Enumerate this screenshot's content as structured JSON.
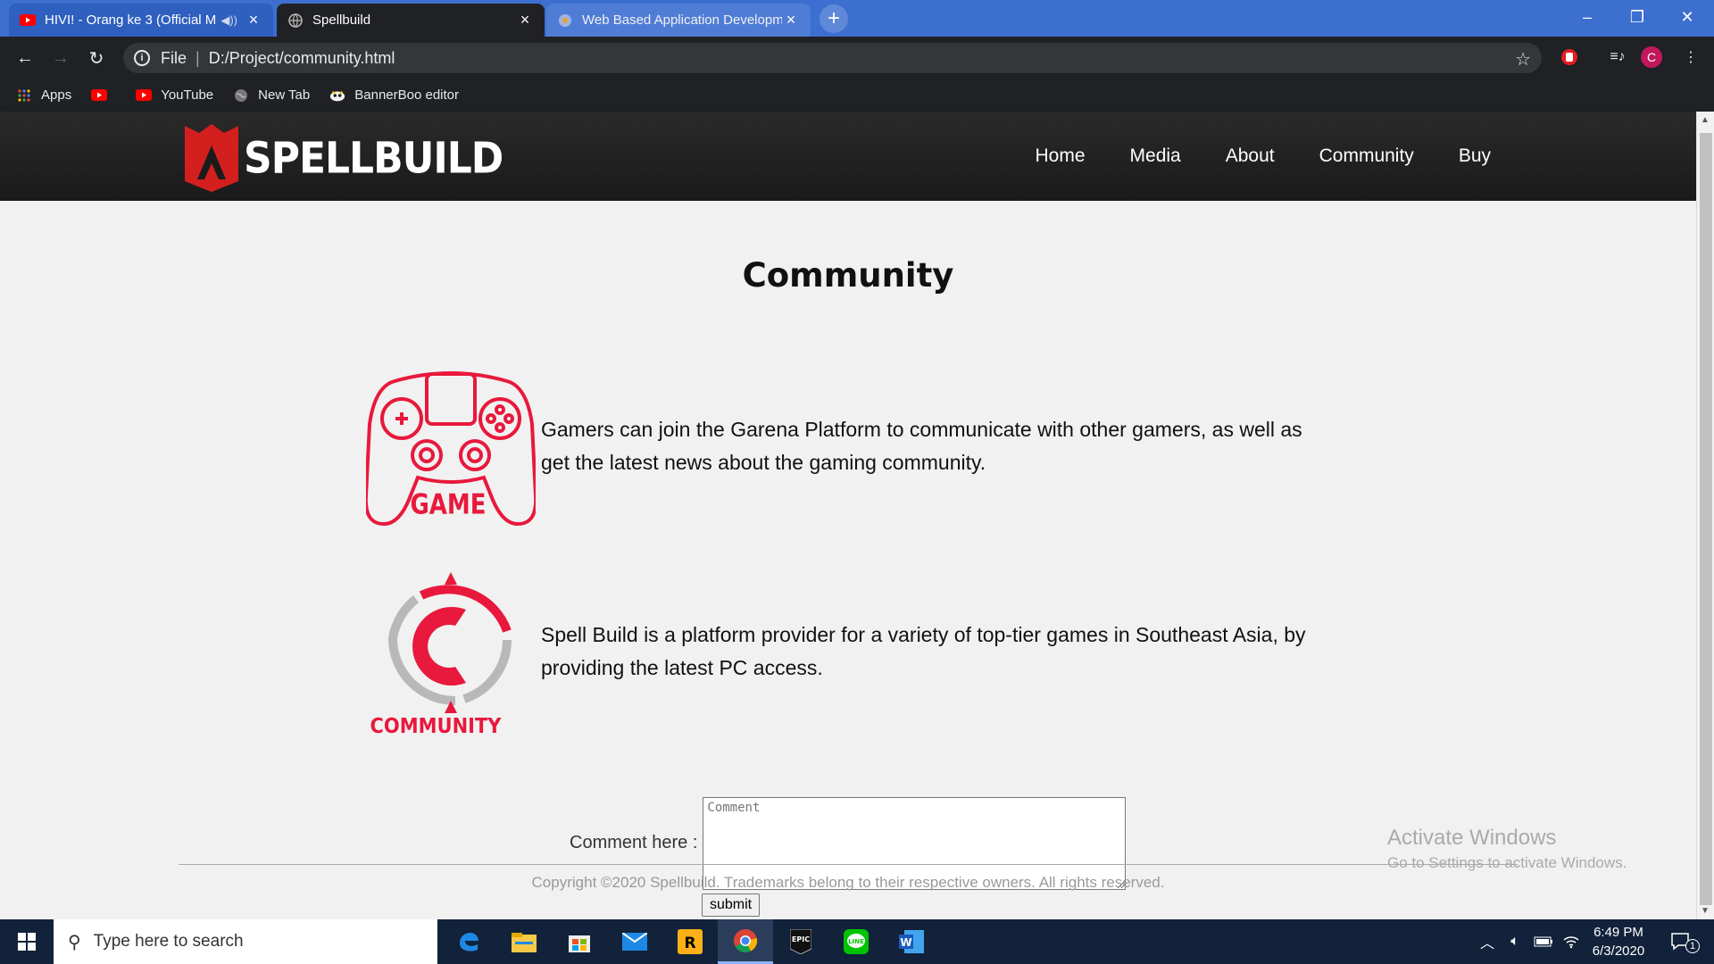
{
  "browser": {
    "tabs": [
      {
        "title": "HIVI! - Orang ke 3 (Official M",
        "icon": "youtube-icon"
      },
      {
        "title": "Spellbuild",
        "icon": "globe-icon"
      },
      {
        "title": "Web Based Application Developm",
        "icon": "page-icon"
      }
    ],
    "url_scheme": "File",
    "url": "D:/Project/community.html",
    "profile_initial": "C",
    "bookmarks": [
      {
        "label": "Apps",
        "icon": "apps-grid-icon"
      },
      {
        "label": "",
        "icon": "youtube-icon"
      },
      {
        "label": "YouTube",
        "icon": "youtube-icon"
      },
      {
        "label": "New Tab",
        "icon": "globe-icon"
      },
      {
        "label": "BannerBoo editor",
        "icon": "bannerboo-icon"
      }
    ]
  },
  "site": {
    "brand": "SPELLBUILD",
    "nav": [
      "Home",
      "Media",
      "About",
      "Community",
      "Buy"
    ],
    "page_title": "Community",
    "features": [
      {
        "icon_label": "GAME",
        "icon": "gamepad-icon",
        "text": "Gamers can join the Garena Platform to communicate with other gamers, as well as get the latest news about the gaming community."
      },
      {
        "icon_label": "COMMUNITY",
        "icon": "community-icon",
        "text": "Spell Build is a platform provider for a variety of top-tier games in Southeast Asia, by providing the latest PC access."
      }
    ],
    "comment_label": "Comment here :",
    "comment_placeholder": "Comment",
    "submit_label": "submit",
    "copyright": "Copyright ©2020 Spellbuild. Trademarks belong to their respective owners. All rights reserved.",
    "accent_color": "#e8193c"
  },
  "watermark": {
    "line1": "Activate Windows",
    "line2": "Go to Settings to activate Windows."
  },
  "taskbar": {
    "search_placeholder": "Type here to search",
    "time": "6:49 PM",
    "date": "6/3/2020",
    "notification_count": "1"
  }
}
